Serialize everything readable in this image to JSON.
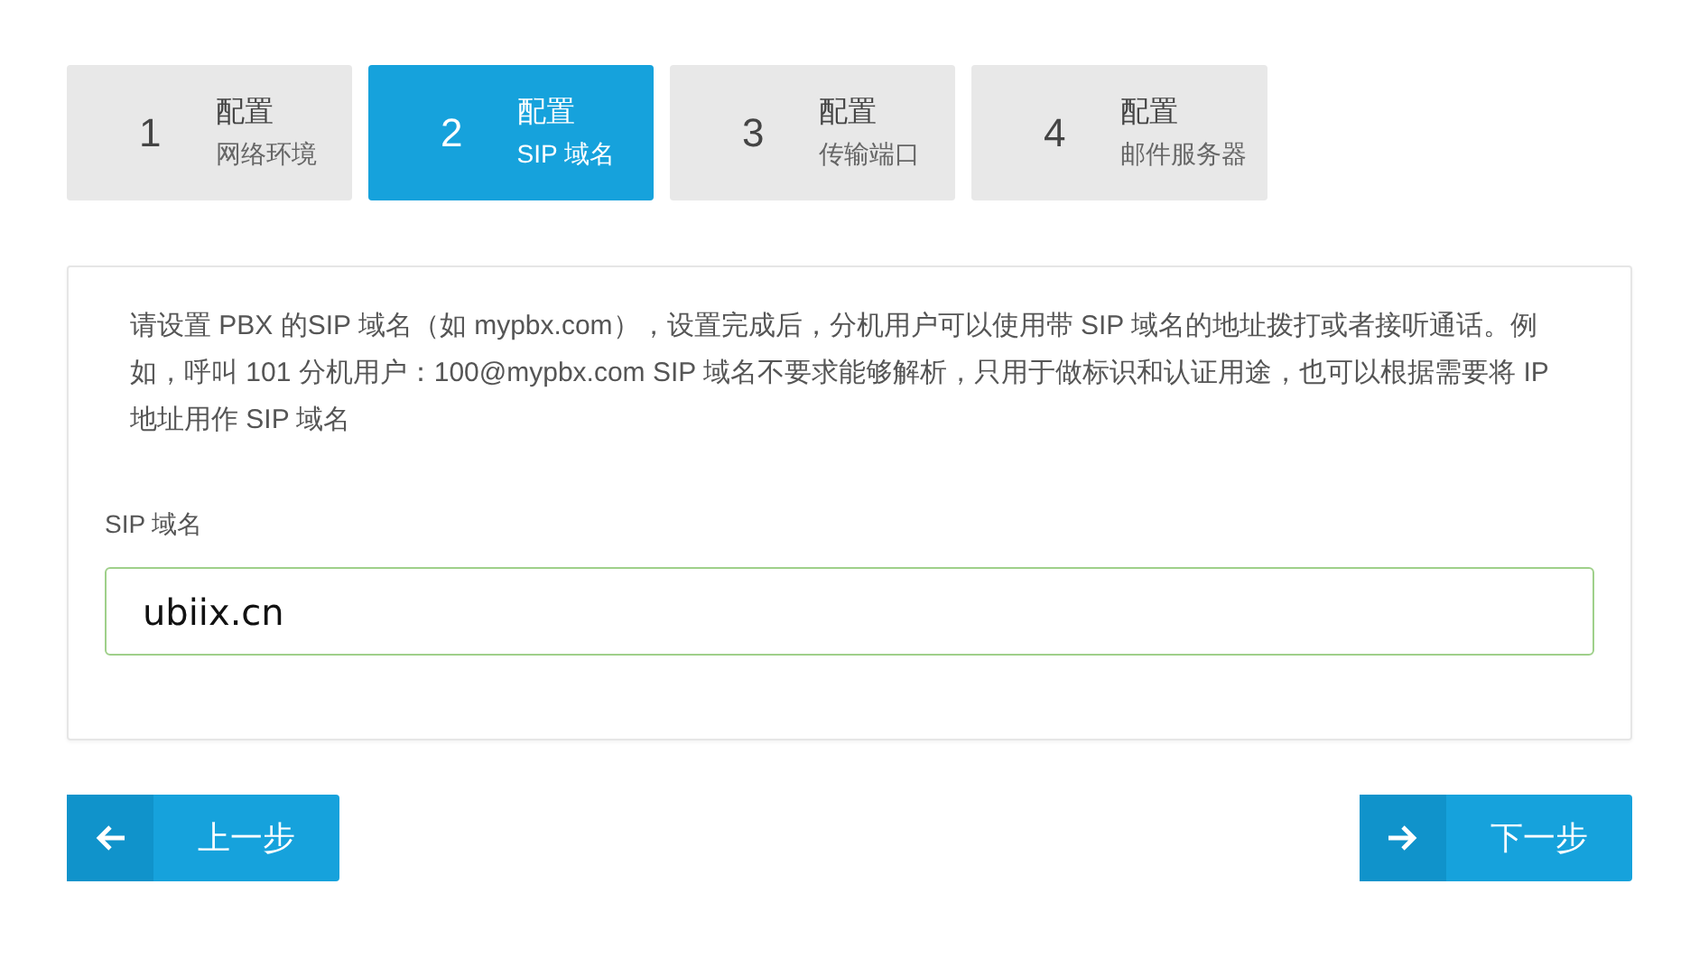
{
  "steps": [
    {
      "number": "1",
      "title": "配置",
      "subtitle": "网络环境",
      "selected": false
    },
    {
      "number": "2",
      "title": "配置",
      "subtitle": "SIP 域名",
      "selected": true
    },
    {
      "number": "3",
      "title": "配置",
      "subtitle": "传输端口",
      "selected": false
    },
    {
      "number": "4",
      "title": "配置",
      "subtitle": "邮件服务器",
      "selected": false
    }
  ],
  "description": "请设置 PBX 的SIP 域名（如 mypbx.com），设置完成后，分机用户可以使用带 SIP 域名的地址拨打或者接听通话。例如，呼叫 101 分机用户：100@mypbx.com SIP 域名不要求能够解析，只用于做标识和认证用途，也可以根据需要将 IP 地址用作 SIP 域名",
  "field": {
    "label": "SIP 域名",
    "value": "ubiix.cn"
  },
  "buttons": [
    {
      "kind": "prev",
      "label": "上一步"
    },
    {
      "kind": "next",
      "label": "下一步"
    }
  ]
}
